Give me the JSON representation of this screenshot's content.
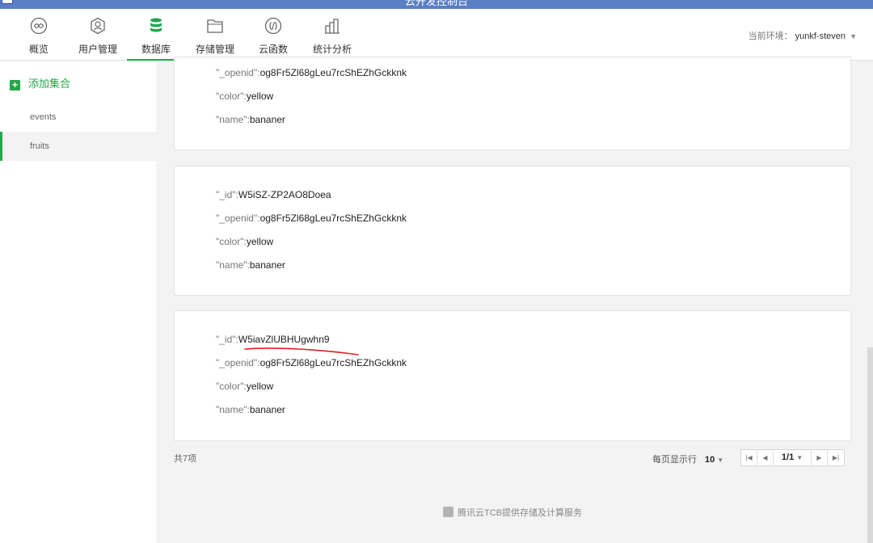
{
  "window": {
    "title": "云开发控制台"
  },
  "nav": {
    "items": [
      {
        "label": "概览",
        "icon": "overview-icon"
      },
      {
        "label": "用户管理",
        "icon": "user-icon"
      },
      {
        "label": "数据库",
        "icon": "database-icon"
      },
      {
        "label": "存储管理",
        "icon": "folder-icon"
      },
      {
        "label": "云函数",
        "icon": "function-icon"
      },
      {
        "label": "统计分析",
        "icon": "stats-icon"
      }
    ],
    "active_index": 2,
    "env_label": "当前环境：",
    "env_value": "yunkf-steven"
  },
  "sidebar": {
    "add_label": "添加集合",
    "collections": [
      "events",
      "fruits"
    ],
    "active": "fruits"
  },
  "records": [
    {
      "fields": [
        {
          "key": "\"_openid\":",
          "value": "og8Fr5Zl68gLeu7rcShEZhGckknk"
        },
        {
          "key": "\"color\":",
          "value": "yellow"
        },
        {
          "key": "\"name\":",
          "value": "bananer"
        }
      ]
    },
    {
      "fields": [
        {
          "key": "\"_id\":",
          "value": "W5iSZ-ZP2AO8Doea"
        },
        {
          "key": "\"_openid\":",
          "value": "og8Fr5Zl68gLeu7rcShEZhGckknk"
        },
        {
          "key": "\"color\":",
          "value": "yellow"
        },
        {
          "key": "\"name\":",
          "value": "bananer"
        }
      ]
    },
    {
      "fields": [
        {
          "key": "\"_id\":",
          "value": "W5iavZlUBHUgwhn9"
        },
        {
          "key": "\"_openid\":",
          "value": "og8Fr5Zl68gLeu7rcShEZhGckknk"
        },
        {
          "key": "\"color\":",
          "value": "yellow"
        },
        {
          "key": "\"name\":",
          "value": "bananer"
        }
      ]
    }
  ],
  "pagination": {
    "total": "共7项",
    "per_page_label": "每页显示行",
    "per_page_value": "10",
    "page": "1/1"
  },
  "footer": {
    "text": "腾讯云TCB提供存储及计算服务"
  },
  "colors": {
    "accent": "#21a84a",
    "annotation": "#e02020",
    "titlebar": "#5b7fc6"
  }
}
